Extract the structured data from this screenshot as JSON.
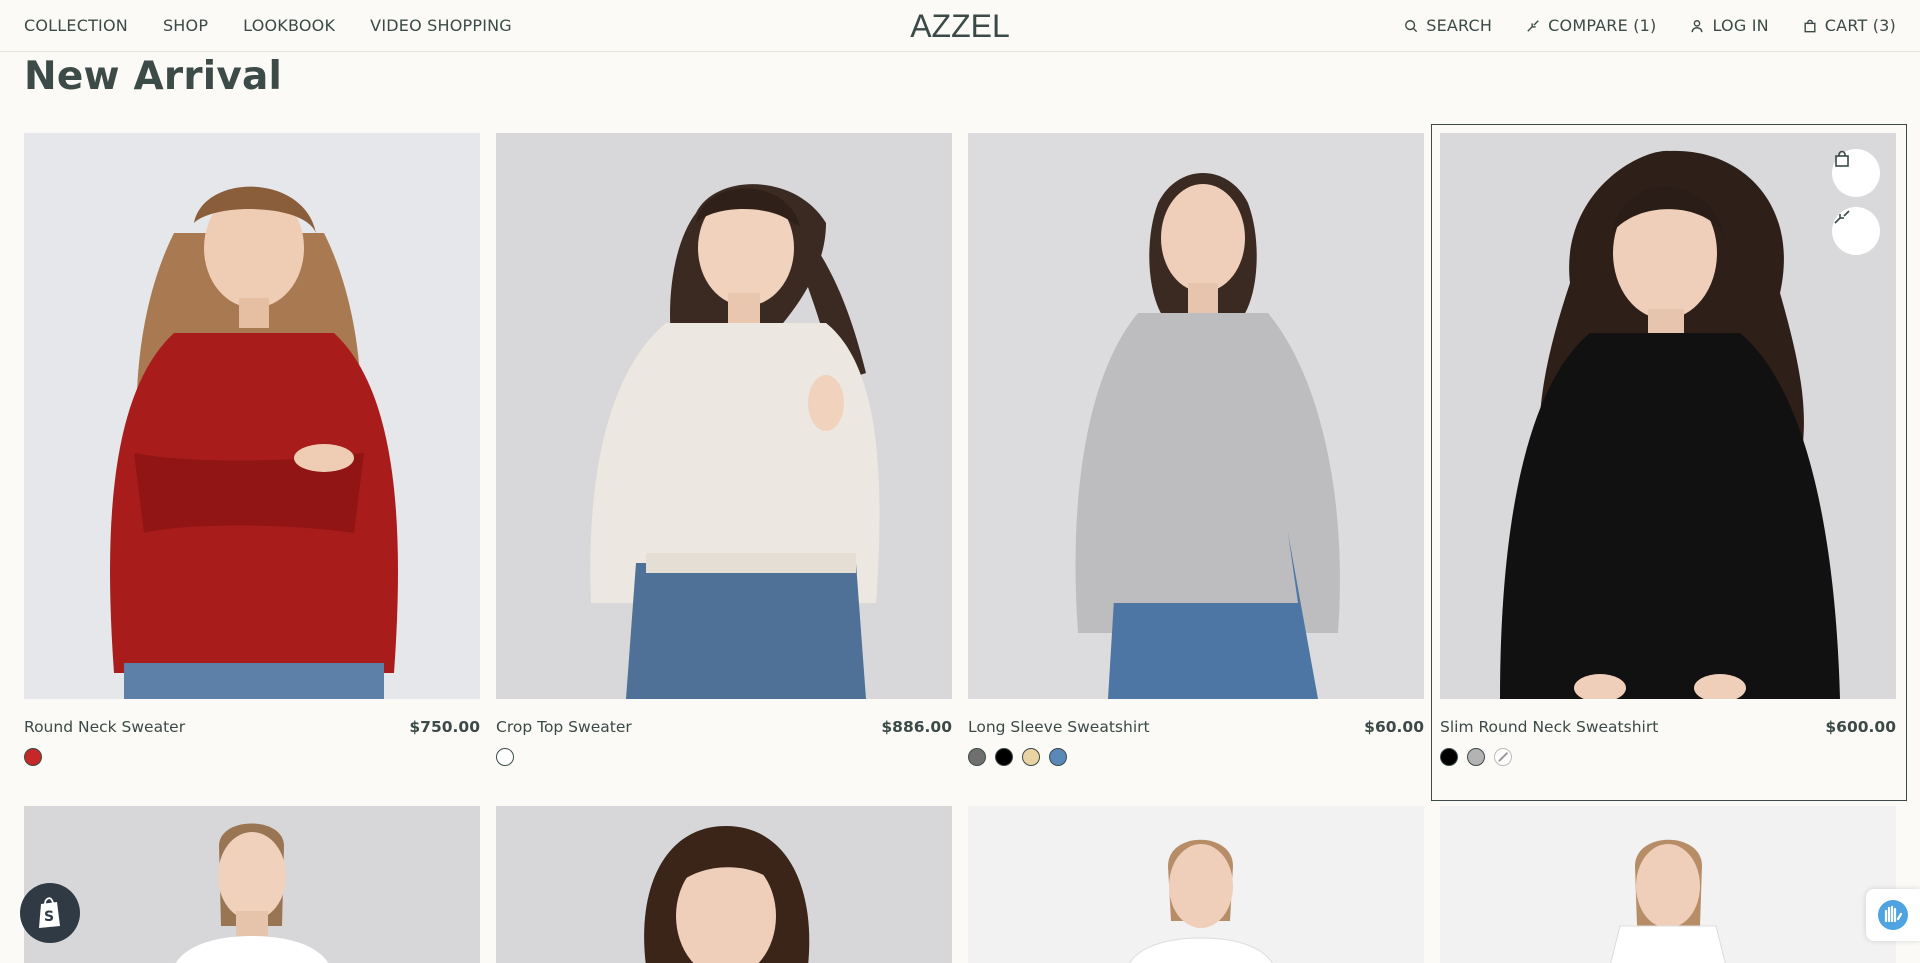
{
  "header": {
    "nav_left": [
      "COLLECTION",
      "SHOP",
      "LOOKBOOK",
      "VIDEO SHOPPING"
    ],
    "logo": "AZZEL",
    "search_label": "SEARCH",
    "compare_label": "COMPARE (1)",
    "login_label": "LOG IN",
    "cart_label": "CART (3)"
  },
  "page_title": "New Arrival",
  "products": [
    {
      "name": "Round Neck Sweater",
      "price": "$750.00",
      "swatches": [
        "#c62828"
      ],
      "sweater_color": "#a81c1c"
    },
    {
      "name": "Crop Top Sweater",
      "price": "$886.00",
      "swatches": [
        "#ffffff"
      ],
      "sweater_color": "#ece8e1"
    },
    {
      "name": "Long Sleeve Sweatshirt",
      "price": "$60.00",
      "swatches": [
        "#6f6f6f",
        "#000000",
        "#ead3a2",
        "#5a88b8"
      ],
      "sweater_color": "#bdbdbf"
    },
    {
      "name": "Slim Round Neck Sweatshirt",
      "price": "$600.00",
      "swatches": [
        "#000000",
        "#b3b3b3",
        "unavailable"
      ],
      "sweater_color": "#101010"
    }
  ],
  "icons": {
    "search": "search-icon",
    "compare": "compare-icon",
    "user": "user-icon",
    "cart": "bag-icon",
    "quick_add": "bag-icon",
    "quick_compare": "compare-icon",
    "shopify": "shopify-icon",
    "help": "hand-wave-icon"
  }
}
